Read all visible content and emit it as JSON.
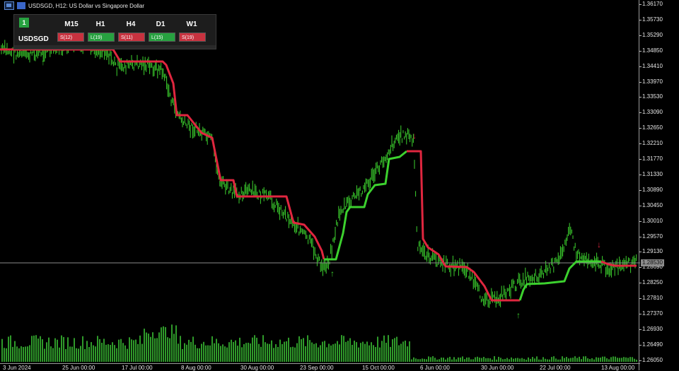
{
  "window": {
    "title": "USDSGD, H12:  US Dollar vs Singapore Dollar"
  },
  "panel": {
    "badge": "1",
    "symbol": "USDSGD",
    "timeframes": [
      {
        "label": "M15",
        "signal": "S(12)",
        "dir": "sell"
      },
      {
        "label": "H1",
        "signal": "L(19)",
        "dir": "buy"
      },
      {
        "label": "H4",
        "signal": "S(11)",
        "dir": "sell"
      },
      {
        "label": "D1",
        "signal": "L(15)",
        "dir": "buy"
      },
      {
        "label": "W1",
        "signal": "S(19)",
        "dir": "sell"
      }
    ]
  },
  "price_axis": {
    "labels": [
      "1.36170",
      "1.35730",
      "1.35290",
      "1.34850",
      "1.34410",
      "1.33970",
      "1.33530",
      "1.33090",
      "1.32650",
      "1.32210",
      "1.31770",
      "1.31330",
      "1.30890",
      "1.30450",
      "1.30010",
      "1.29570",
      "1.29130",
      "1.28690",
      "1.28250",
      "1.27810",
      "1.27370",
      "1.26930",
      "1.26490",
      "1.26050"
    ],
    "current_price": "1.28530"
  },
  "time_axis": {
    "labels": [
      "3 Jun 2024",
      "25 Jun 00:00",
      "17 Jul 00:00",
      "8 Aug 00:00",
      "30 Aug 00:00",
      "23 Sep 00:00",
      "15 Oct 00:00",
      "6 Jun 00:00",
      "30 Jun 00:00",
      "22 Jul 00:00",
      "13 Aug 00:00"
    ]
  },
  "colors": {
    "bull": "#3cd12e",
    "bear": "#e0263f",
    "volume": "#2f9a2a",
    "panel_bg": "#1d1d1d"
  },
  "icons": [
    "chart-window-icon",
    "chart-type-icon",
    "up-arrow-icon",
    "down-arrow-icon"
  ]
}
